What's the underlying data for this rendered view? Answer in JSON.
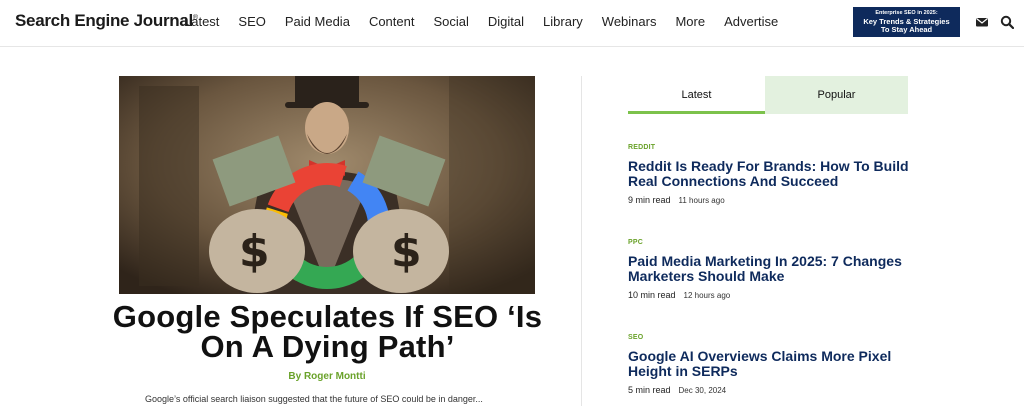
{
  "header": {
    "logo_text": "Search Engine Journal",
    "logo_mark": "®",
    "nav": [
      "Latest",
      "SEO",
      "Paid Media",
      "Content",
      "Social",
      "Digital",
      "Library",
      "Webinars",
      "More",
      "Advertise"
    ],
    "ad_line1": "Enterprise SEO in 2025:",
    "ad_line2": "Key Trends & Strategies",
    "ad_line3": "To Stay Ahead"
  },
  "feature": {
    "headline": "Google Speculates If SEO ‘Is On A Dying Path’",
    "byline_prefix": "By",
    "author": "Roger Montti",
    "teaser": "Google’s official search liaison suggested that the future of SEO could be in danger..."
  },
  "sidebar": {
    "tabs": [
      "Latest",
      "Popular"
    ],
    "articles": [
      {
        "category": "REDDIT",
        "title": "Reddit Is Ready For Brands: How To Build Real Connections And Succeed",
        "read": "9 min read",
        "ago": "11 hours ago"
      },
      {
        "category": "PPC",
        "title": "Paid Media Marketing In 2025: 7 Changes Marketers Should Make",
        "read": "10 min read",
        "ago": "12 hours ago"
      },
      {
        "category": "SEO",
        "title": "Google AI Overviews Claims More Pixel Height in SERPs",
        "read": "5 min read",
        "ago": "Dec 30, 2024"
      }
    ]
  },
  "colors": {
    "brand_green": "#6aa22a",
    "brand_navy": "#0e2a5c",
    "tab_active_bg": "#e3f1df"
  }
}
